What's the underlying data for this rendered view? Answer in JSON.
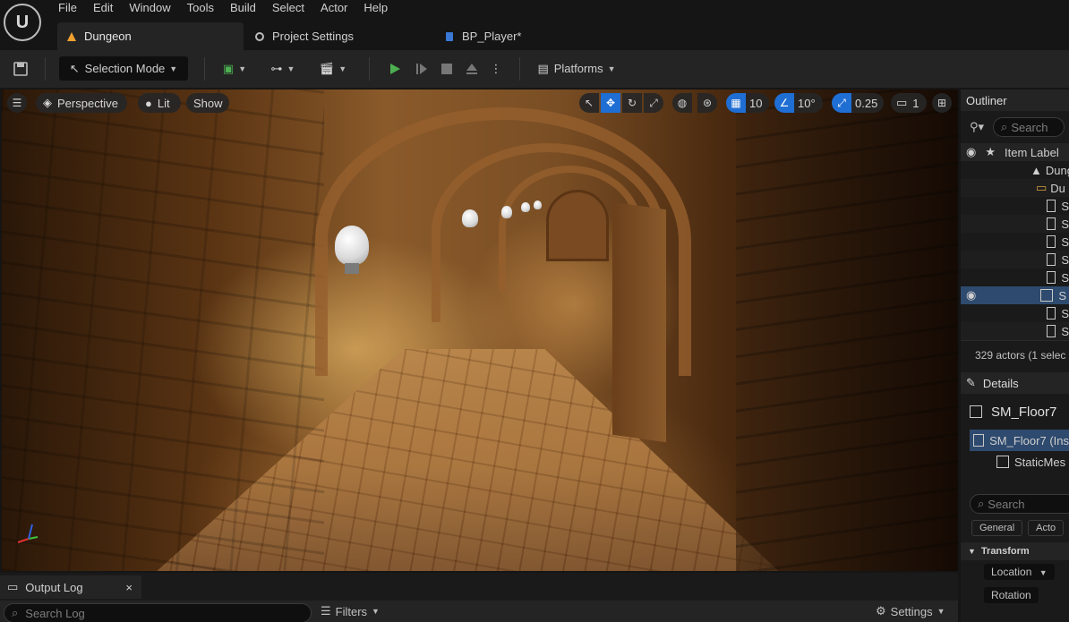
{
  "menu": [
    "File",
    "Edit",
    "Window",
    "Tools",
    "Build",
    "Select",
    "Actor",
    "Help"
  ],
  "tabs": [
    {
      "label": "Dungeon",
      "active": true
    },
    {
      "label": "Project Settings",
      "active": false
    },
    {
      "label": "BP_Player*",
      "active": false
    }
  ],
  "toolbar": {
    "selection_mode": "Selection Mode",
    "platforms": "Platforms"
  },
  "viewport": {
    "perspective": "Perspective",
    "lit": "Lit",
    "show": "Show",
    "grid_snap": "10",
    "rotation_snap": "10°",
    "scale_snap": "0.25",
    "camera_speed": "1"
  },
  "outliner": {
    "title": "Outliner",
    "search_placeholder": "Search",
    "column_label": "Item Label",
    "folder_world": "Dung",
    "folder_sub": "Du",
    "row_letter": "S",
    "actor_count": "329 actors (1 selec"
  },
  "details": {
    "title": "Details",
    "object_name": "SM_Floor7",
    "instance_row": "SM_Floor7 (Ins",
    "component_row": "StaticMes",
    "search_placeholder": "Search",
    "tab_general": "General",
    "tab_actor": "Acto",
    "section_transform": "Transform",
    "location_label": "Location",
    "rotation_label": "Rotation"
  },
  "output_log": {
    "tab_label": "Output Log",
    "search_placeholder": "Search Log",
    "filters": "Filters",
    "settings": "Settings"
  },
  "colors": {
    "accent_blue": "#1f6ed4",
    "play_green": "#4caf50",
    "tab_orange": "#f0a030"
  }
}
